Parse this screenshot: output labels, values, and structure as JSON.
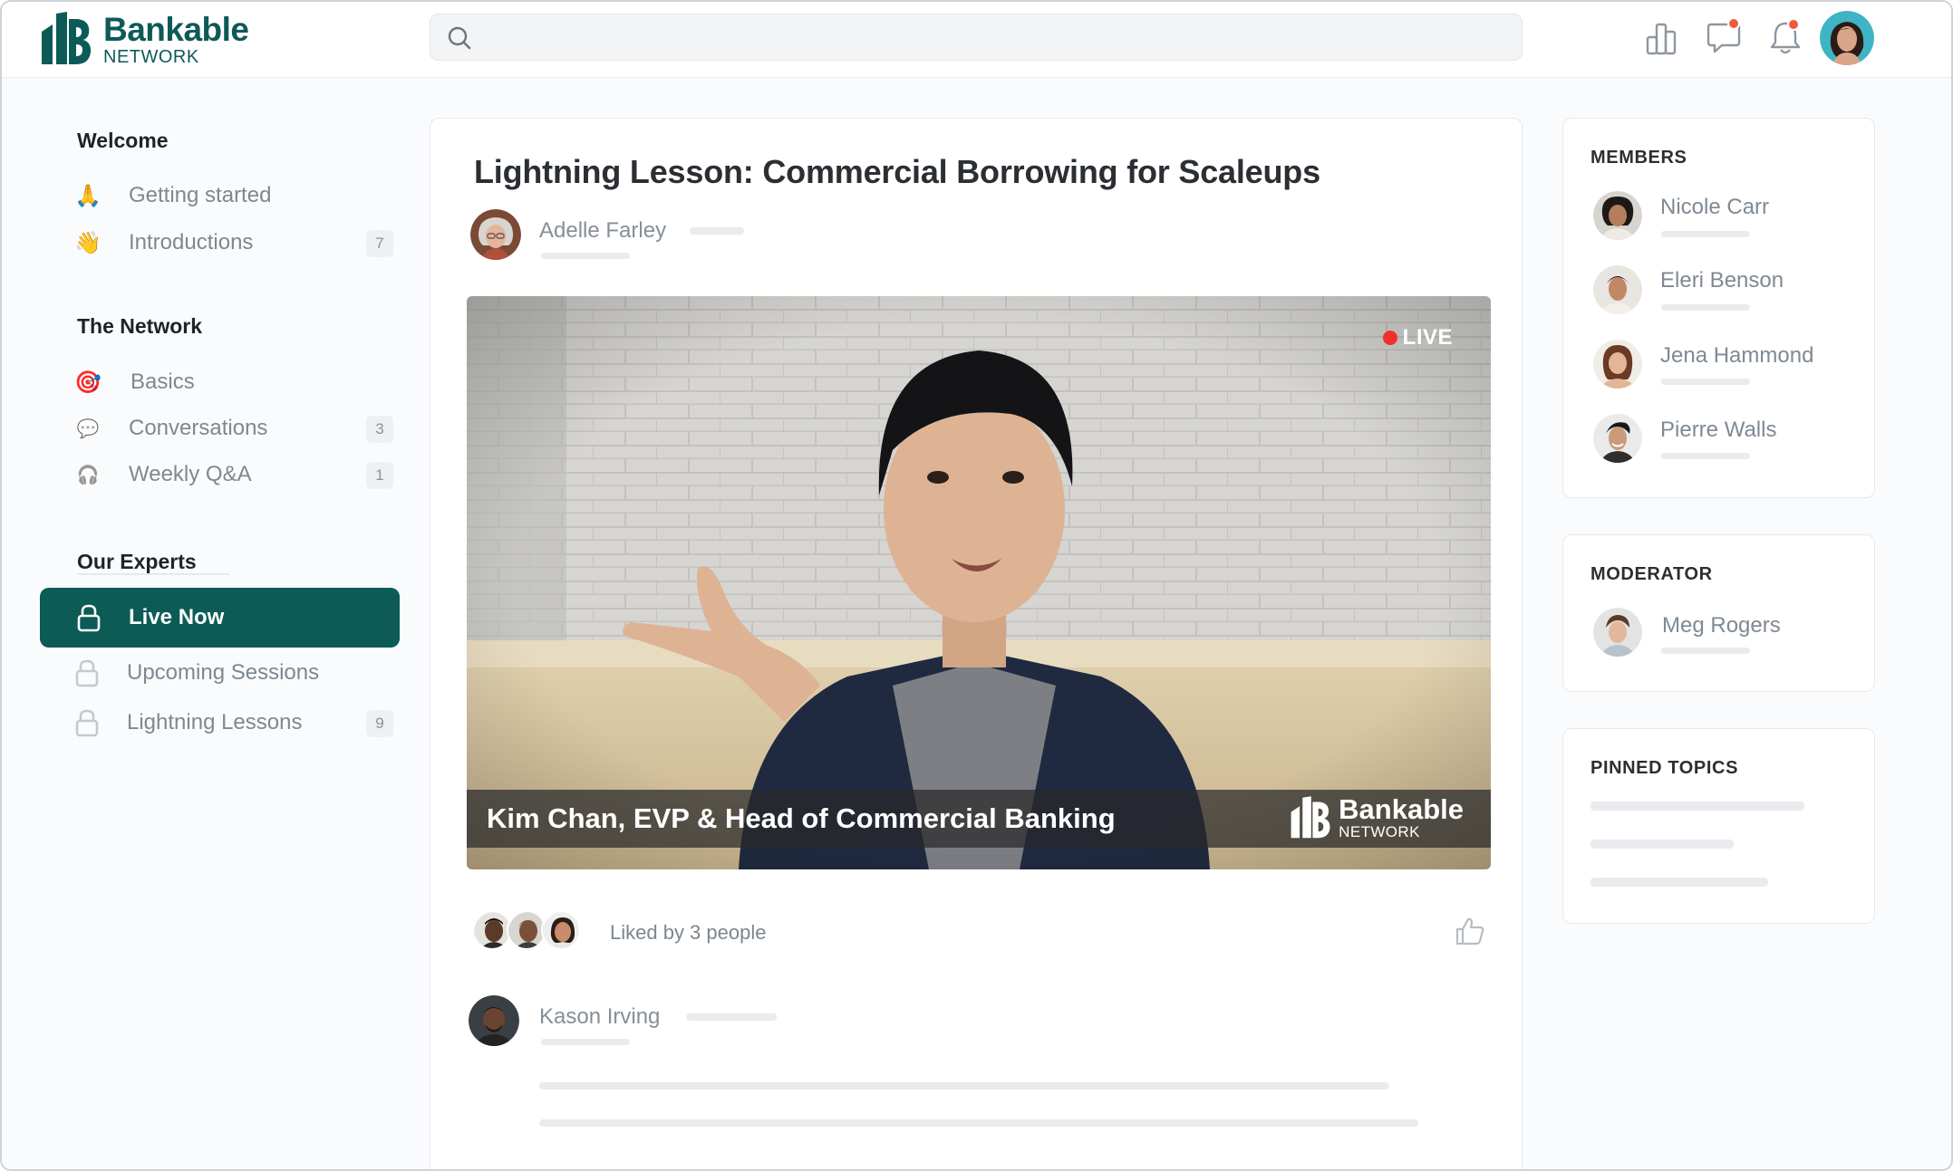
{
  "brand": {
    "name": "Bankable",
    "sub": "NETWORK",
    "color": "#0c5b57"
  },
  "search": {
    "placeholder": "",
    "value": ""
  },
  "header_icons": [
    "chart-icon",
    "chat-icon",
    "bell-icon"
  ],
  "sidebar": {
    "sections": [
      {
        "title": "Welcome",
        "items": [
          {
            "icon": "🙏",
            "label": "Getting started",
            "count": ""
          },
          {
            "icon": "👋",
            "label": "Introductions",
            "count": "7"
          }
        ]
      },
      {
        "title": "The Network",
        "items": [
          {
            "icon": "🎯",
            "label": "Basics",
            "count": ""
          },
          {
            "icon": "💬",
            "label": "Conversations",
            "count": "3"
          },
          {
            "icon": "🎧",
            "label": "Weekly Q&A",
            "count": "1"
          }
        ]
      },
      {
        "title": "Our Experts",
        "items": [
          {
            "icon": "lock-icon",
            "label": "Live Now",
            "count": "",
            "active": true
          },
          {
            "icon": "lock-icon",
            "label": "Upcoming Sessions",
            "count": ""
          },
          {
            "icon": "lock-icon",
            "label": "Lightning Lessons",
            "count": "9"
          }
        ]
      }
    ]
  },
  "post": {
    "title": "Lightning Lesson: Commercial Borrowing for Scaleups",
    "author": "Adelle Farley",
    "video": {
      "live_label": "LIVE",
      "caption": "Kim Chan, EVP & Head of Commercial Banking",
      "brand_name": "Bankable",
      "brand_sub": "NETWORK"
    },
    "liked_text": "Liked by 3 people",
    "comment_author": "Kason Irving"
  },
  "members": {
    "title": "MEMBERS",
    "list": [
      "Nicole Carr",
      "Eleri Benson",
      "Jena Hammond",
      "Pierre Walls"
    ]
  },
  "moderator": {
    "title": "MODERATOR",
    "name": "Meg Rogers"
  },
  "pinned": {
    "title": "PINNED TOPICS"
  }
}
